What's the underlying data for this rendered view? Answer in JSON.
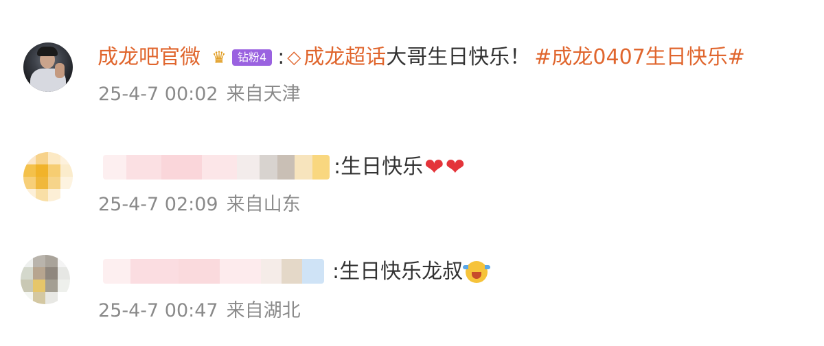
{
  "comments": [
    {
      "username": "成龙吧官微",
      "badge_level": "钻粉4",
      "colon": ":",
      "topic": "成龙超话",
      "text": "大哥生日快乐！",
      "hashtag": "#成龙0407生日快乐#",
      "timestamp": "25-4-7 00:02",
      "location": "来自天津"
    },
    {
      "username_blurred": true,
      "colon": ":",
      "text": "生日快乐",
      "emojis": [
        "heart-icon",
        "heart-icon"
      ],
      "timestamp": "25-4-7 02:09",
      "location": "来自山东"
    },
    {
      "username_blurred": true,
      "colon": ":",
      "text": "生日快乐龙叔",
      "emojis": [
        "crying-face-icon"
      ],
      "timestamp": "25-4-7 00:47",
      "location": "来自湖北"
    }
  ],
  "colors": {
    "username": "#e0662e",
    "topic": "#e0662e",
    "meta": "#8a8a8a",
    "badge": "#9a62e0",
    "heart": "#e4343a"
  }
}
